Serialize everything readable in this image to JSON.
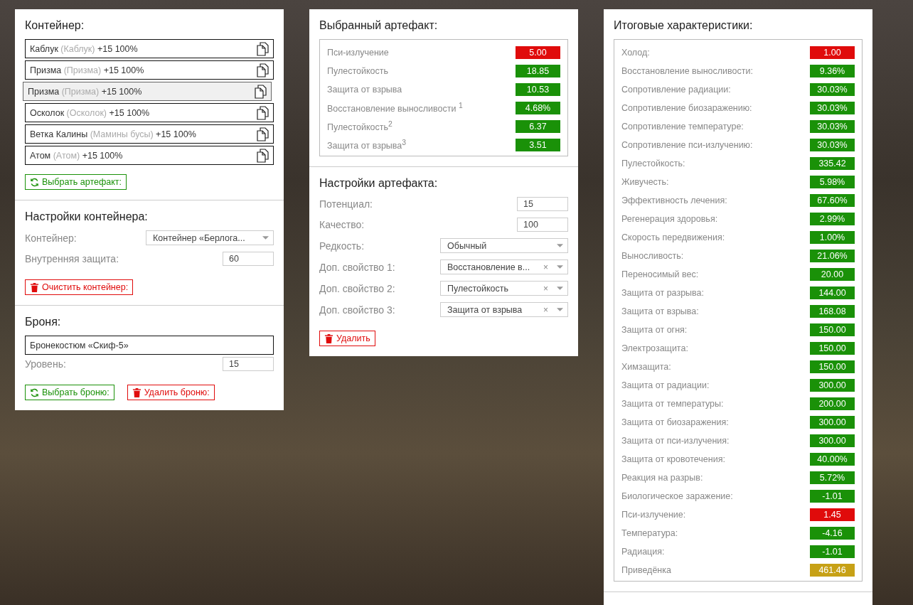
{
  "container": {
    "title": "Контейнер:",
    "items": [
      {
        "name": "Каблук",
        "alias": "(Каблук)",
        "bonus": "+15 100%",
        "selected": false
      },
      {
        "name": "Призма",
        "alias": "(Призма)",
        "bonus": "+15 100%",
        "selected": false
      },
      {
        "name": "Призма",
        "alias": "(Призма)",
        "bonus": "+15 100%",
        "selected": true
      },
      {
        "name": "Осколок",
        "alias": "(Осколок)",
        "bonus": "+15 100%",
        "selected": false
      },
      {
        "name": "Ветка Калины",
        "alias": "(Мамины бусы)",
        "bonus": "+15 100%",
        "selected": false
      },
      {
        "name": "Атом",
        "alias": "(Атом)",
        "bonus": "+15 100%",
        "selected": false
      }
    ],
    "button": {
      "label": "Выбрать артефакт:",
      "kind": "refresh"
    }
  },
  "container_settings": {
    "title": "Настройки контейнера:",
    "fields": [
      {
        "kind": "select",
        "label": "Контейнер:",
        "value": "Контейнер «Берлога..."
      },
      {
        "kind": "number",
        "label": "Внутренняя защита:",
        "value": "60"
      }
    ],
    "button": {
      "label": "Очистить контейнер:",
      "kind": "delete"
    }
  },
  "armor": {
    "title": "Броня:",
    "item": "Бронекостюм «Скиф-5»",
    "fields": [
      {
        "kind": "number",
        "label": "Уровень:",
        "value": "15"
      }
    ],
    "buttons": [
      {
        "label": "Выбрать броню:",
        "kind": "refresh"
      },
      {
        "label": "Удалить броню:",
        "kind": "delete"
      }
    ]
  },
  "selected_artifact": {
    "title": "Выбранный артефакт:",
    "stats": [
      {
        "label": "Пси-излучение",
        "value": "5.00",
        "color": "#e00b0b"
      },
      {
        "label": "Пулестойкость",
        "value": "18.85",
        "color": "#1a9108"
      },
      {
        "label": "Защита от взрыва",
        "value": "10.53",
        "color": "#1a9108"
      },
      {
        "label": "Восстановление выносливости $^{1}$",
        "value": "4.68%",
        "color": "#1a9108"
      },
      {
        "label": "Пулестойкость$^{2}$",
        "value": "6.37",
        "color": "#1a9108"
      },
      {
        "label": "Защита от взрыва$^{3}$",
        "value": "3.51",
        "color": "#1a9108"
      }
    ]
  },
  "artifact_settings": {
    "title": "Настройки артефакта:",
    "fields": [
      {
        "kind": "number",
        "label": "Потенциал:",
        "value": "15"
      },
      {
        "kind": "number",
        "label": "Качество:",
        "value": "100"
      },
      {
        "kind": "select",
        "label": "Редкость:",
        "value": "Обычный"
      },
      {
        "kind": "select",
        "label": "Доп. свойство 1:",
        "value": "Восстановление в...",
        "clear": "×"
      },
      {
        "kind": "select",
        "label": "Доп. свойство 2:",
        "value": "Пулестойкость",
        "clear": "×"
      },
      {
        "kind": "select",
        "label": "Доп. свойство 3:",
        "value": "Защита от взрыва",
        "clear": "×"
      }
    ],
    "button": {
      "label": "Удалить",
      "kind": "delete"
    }
  },
  "totals": {
    "title": "Итоговые характеристики:",
    "stats": [
      {
        "label": "Холод:",
        "value": "1.00",
        "color": "#e00b0b"
      },
      {
        "label": "Восстановление выносливости:",
        "value": "9.36%",
        "color": "#1a9108"
      },
      {
        "label": "Сопротивление радиации:",
        "value": "30.03%",
        "color": "#1a9108"
      },
      {
        "label": "Сопротивление биозаражению:",
        "value": "30.03%",
        "color": "#1a9108"
      },
      {
        "label": "Сопротивление температуре:",
        "value": "30.03%",
        "color": "#1a9108"
      },
      {
        "label": "Сопротивление пси-излучению:",
        "value": "30.03%",
        "color": "#1a9108"
      },
      {
        "label": "Пулестойкость:",
        "value": "335.42",
        "color": "#1a9108"
      },
      {
        "label": "Живучесть:",
        "value": "5.98%",
        "color": "#1a9108"
      },
      {
        "label": "Эффективность лечения:",
        "value": "67.60%",
        "color": "#1a9108"
      },
      {
        "label": "Регенерация здоровья:",
        "value": "2.99%",
        "color": "#1a9108"
      },
      {
        "label": "Скорость передвижения:",
        "value": "1.00%",
        "color": "#1a9108"
      },
      {
        "label": "Выносливость:",
        "value": "21.06%",
        "color": "#1a9108"
      },
      {
        "label": "Переносимый вес:",
        "value": "20.00",
        "color": "#1a9108"
      },
      {
        "label": "Защита от разрыва:",
        "value": "144.00",
        "color": "#1a9108"
      },
      {
        "label": "Защита от взрыва:",
        "value": "168.08",
        "color": "#1a9108"
      },
      {
        "label": "Защита от огня:",
        "value": "150.00",
        "color": "#1a9108"
      },
      {
        "label": "Электрозащита:",
        "value": "150.00",
        "color": "#1a9108"
      },
      {
        "label": "Химзащита:",
        "value": "150.00",
        "color": "#1a9108"
      },
      {
        "label": "Защита от радиации:",
        "value": "300.00",
        "color": "#1a9108"
      },
      {
        "label": "Защита от температуры:",
        "value": "200.00",
        "color": "#1a9108"
      },
      {
        "label": "Защита от биозаражения:",
        "value": "300.00",
        "color": "#1a9108"
      },
      {
        "label": "Защита от пси-излучения:",
        "value": "300.00",
        "color": "#1a9108"
      },
      {
        "label": "Защита от кровотечения:",
        "value": "40.00%",
        "color": "#1a9108"
      },
      {
        "label": "Реакция на разрыв:",
        "value": "5.72%",
        "color": "#1a9108"
      },
      {
        "label": "Биологическое заражение:",
        "value": "-1.01",
        "color": "#1a9108"
      },
      {
        "label": "Пси-излучение:",
        "value": "1.45",
        "color": "#e00b0b"
      },
      {
        "label": "Температура:",
        "value": "-4.16",
        "color": "#1a9108"
      },
      {
        "label": "Радиация:",
        "value": "-1.01",
        "color": "#1a9108"
      },
      {
        "label": "Приведёнка",
        "value": "461.46",
        "color": "#c7a116"
      }
    ]
  }
}
